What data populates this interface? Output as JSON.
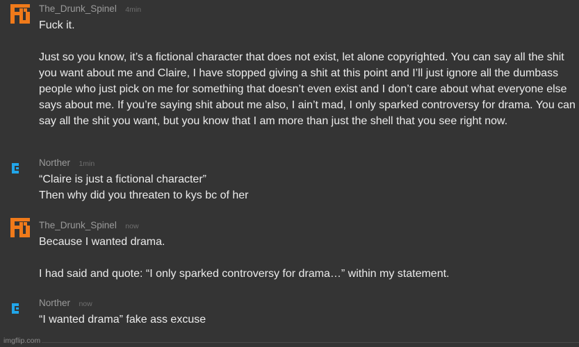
{
  "colors": {
    "background": "#343434",
    "text": "#ececec",
    "username": "#9b9b9b",
    "timestamp": "#6f6f6f",
    "avatar_spinel": "#f07a1a",
    "avatar_norther": "#21a6ea"
  },
  "comments": [
    {
      "username": "The_Drunk_Spinel",
      "time": "4min",
      "avatar_icon": "orange-pixel-avatar-icon",
      "paragraphs": [
        "Fuck it.",
        "Just so you know, it’s a fictional character that does not exist, let alone copyrighted. You can say all the shit you want about me and Claire, I have stopped giving a shit at this point and I’ll just ignore all the dumbass people who just pick on me for something that doesn’t even exist and I don’t care about what everyone else says about me. If you’re saying shit about me also, I ain’t mad, I only sparked controversy for drama. You can say all the shit you want, but you know that I am more than just the shell that you see right now."
      ]
    },
    {
      "username": "Norther",
      "time": "1min",
      "avatar_icon": "blue-pixel-avatar-icon",
      "paragraphs": [
        "“Claire is just a fictional character”\nThen why did you threaten to kys bc of her"
      ]
    },
    {
      "username": "The_Drunk_Spinel",
      "time": "now",
      "avatar_icon": "orange-pixel-avatar-icon",
      "paragraphs": [
        "Because I wanted drama.",
        "I had said and quote: “I only sparked controversy for drama…” within my statement."
      ]
    },
    {
      "username": "Norther",
      "time": "now",
      "avatar_icon": "blue-pixel-avatar-icon",
      "paragraphs": [
        "“I wanted drama” fake ass excuse"
      ]
    }
  ],
  "watermark": "imgflip.com"
}
